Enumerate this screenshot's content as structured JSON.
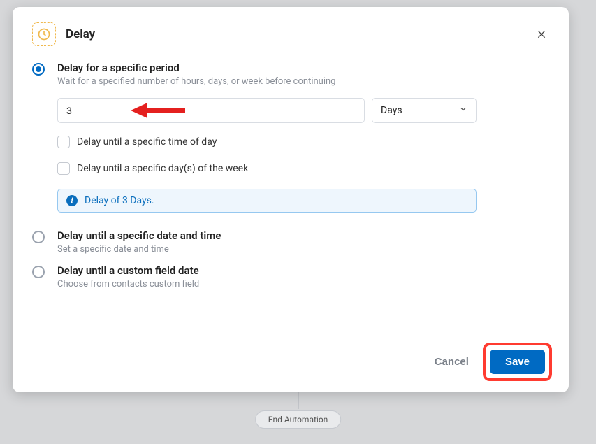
{
  "end_pill": "End Automation",
  "modal": {
    "title": "Delay",
    "options": {
      "period": {
        "title": "Delay for a specific period",
        "desc": "Wait for a specified number of hours, days, or week before continuing",
        "value": "3",
        "unit": "Days",
        "check_time": "Delay until a specific time of day",
        "check_dow": "Delay until a specific day(s) of the week",
        "info": "Delay of 3 Days."
      },
      "datetime": {
        "title": "Delay until a specific date and time",
        "desc": "Set a specific date and time"
      },
      "custom": {
        "title": "Delay until a custom field date",
        "desc": "Choose from contacts custom field"
      }
    },
    "footer": {
      "cancel": "Cancel",
      "save": "Save"
    }
  }
}
